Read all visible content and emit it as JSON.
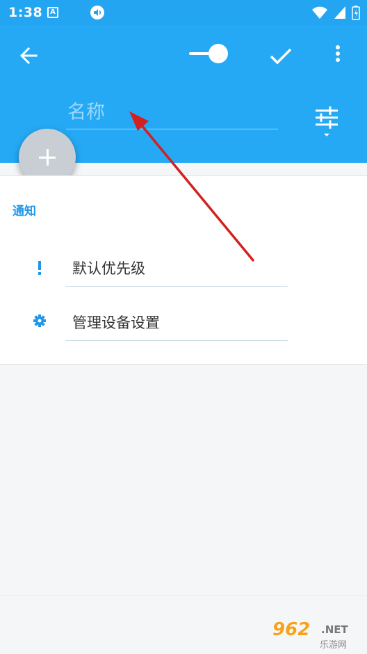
{
  "status_bar": {
    "time": "1:38",
    "notification_letter": "A"
  },
  "app_bar": {
    "name_placeholder": "名称"
  },
  "content": {
    "section_title": "通知",
    "rows": [
      {
        "label": "默认优先级",
        "icon": "priority-exclamation-icon"
      },
      {
        "label": "管理设备设置",
        "icon": "gear-icon"
      }
    ]
  },
  "watermark": {
    "main": "962",
    "net": ".NET",
    "sub": "乐游网"
  },
  "colors": {
    "app_bar": "#25a9f5",
    "accent": "#2196e8",
    "fab": "#c9ced4",
    "arrow": "#d32020"
  }
}
